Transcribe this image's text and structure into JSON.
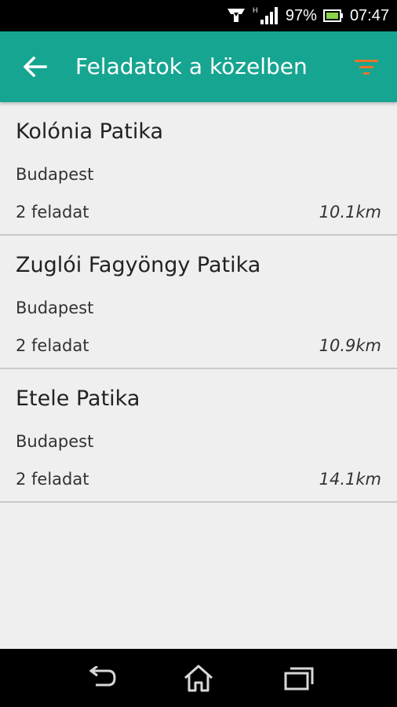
{
  "status_bar": {
    "battery": "97%",
    "time": "07:47",
    "icons": [
      "notification-icon",
      "signal-icon",
      "battery-icon"
    ]
  },
  "app_bar": {
    "title": "Feladatok a közelben",
    "back_icon": "arrow-left-icon",
    "filter_icon": "filter-icon",
    "filter_color": "#e8742a",
    "background_color": "#16a590"
  },
  "list": {
    "items": [
      {
        "name": "Kolónia Patika",
        "city": "Budapest",
        "tasks": "2 feladat",
        "distance": "10.1km"
      },
      {
        "name": "Zuglói Fagyöngy Patika",
        "city": "Budapest",
        "tasks": "2 feladat",
        "distance": "10.9km"
      },
      {
        "name": "Etele Patika",
        "city": "Budapest",
        "tasks": "2 feladat",
        "distance": "14.1km"
      }
    ]
  },
  "nav_bar": {
    "icons": [
      "back-nav-icon",
      "home-icon",
      "recent-apps-icon"
    ]
  }
}
